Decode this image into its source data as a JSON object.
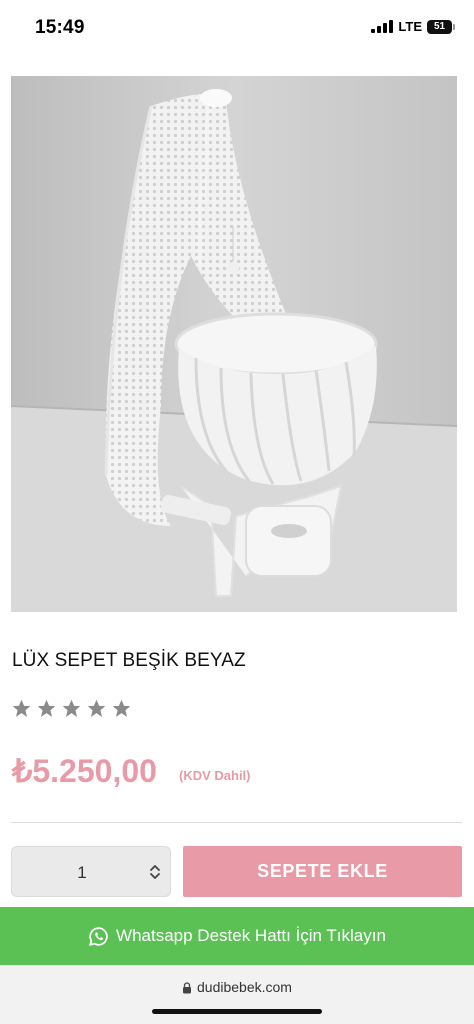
{
  "status_bar": {
    "time": "15:49",
    "network": "LTE",
    "battery": "51"
  },
  "product": {
    "image_alt": "white basket crib with canopy",
    "title": "LÜX SEPET BEŞİK BEYAZ",
    "rating": {
      "stars_filled": 0,
      "stars_total": 5
    },
    "price": "₺5.250,00",
    "tax_note": "(KDV Dahil)"
  },
  "cart": {
    "quantity": "1",
    "add_button_label": "SEPETE EKLE"
  },
  "whatsapp": {
    "label": "Whatsapp Destek Hattı İçin Tıklayın"
  },
  "browser": {
    "url": "dudibebek.com"
  },
  "colors": {
    "accent_pink": "#e89aa6",
    "whatsapp_green": "#5cc155",
    "star_empty": "#8a8a8a"
  },
  "icons": [
    "signal-icon",
    "battery-icon",
    "star-icon",
    "stepper-arrows-icon",
    "whatsapp-icon",
    "lock-icon"
  ]
}
